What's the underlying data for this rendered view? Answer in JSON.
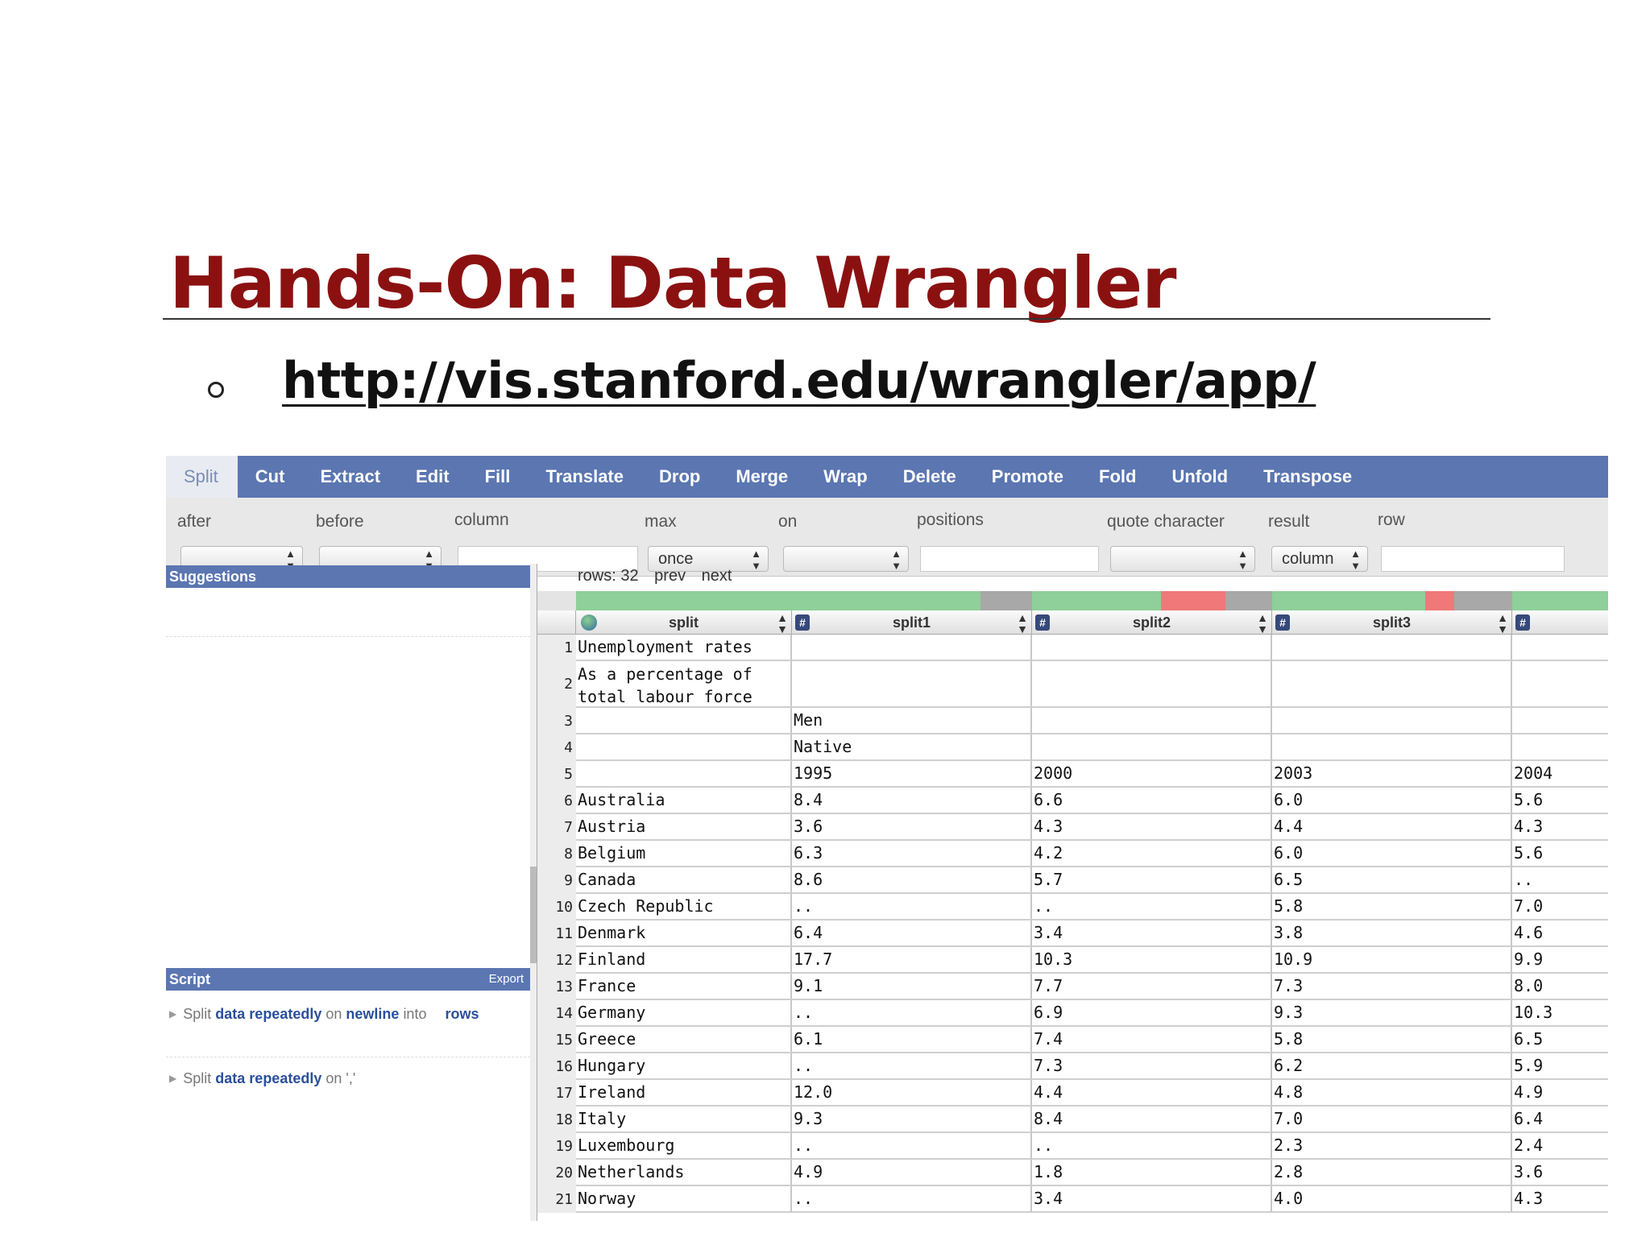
{
  "slide": {
    "title": "Hands-On: Data Wrangler",
    "link": "http://vis.stanford.edu/wrangler/app/"
  },
  "toolbar": {
    "tabs": [
      "Split",
      "Cut",
      "Extract",
      "Edit",
      "Fill",
      "Translate",
      "Drop",
      "Merge",
      "Wrap",
      "Delete",
      "Promote",
      "Fold",
      "Unfold",
      "Transpose"
    ],
    "active_tab": "Split"
  },
  "params": {
    "labels": {
      "after": "after",
      "before": "before",
      "column": "column",
      "max": "max",
      "on": "on",
      "positions": "positions",
      "quote_character": "quote character",
      "result": "result",
      "row": "row"
    },
    "max_value": "once",
    "result_value": "column"
  },
  "suggestions": {
    "title": "Suggestions"
  },
  "script": {
    "title": "Script",
    "export_label": "Export",
    "items": [
      {
        "verb": "Split",
        "kw1": "data",
        "kw2": "repeatedly",
        "mid": "on",
        "kw3": "newline",
        "tail": "into",
        "kw4": "rows"
      },
      {
        "verb": "Split",
        "kw1": "data",
        "kw2": "repeatedly",
        "mid": "on",
        "tail": "','"
      }
    ]
  },
  "grid": {
    "rows_label": "rows: 32",
    "prev_label": "prev",
    "next_label": "next",
    "columns": [
      "split",
      "split1",
      "split2",
      "split3"
    ],
    "colors": {
      "valid": "#8fcf9a",
      "missing": "#a8a8a8",
      "error": "#f07878"
    },
    "rows": [
      {
        "n": "1",
        "c": [
          "Unemployment rates",
          "",
          "",
          "",
          ""
        ]
      },
      {
        "n": "2",
        "c": [
          "As a percentage of total labour force",
          "",
          "",
          "",
          ""
        ]
      },
      {
        "n": "3",
        "c": [
          "",
          "Men",
          "",
          "",
          ""
        ]
      },
      {
        "n": "4",
        "c": [
          "",
          "Native",
          "",
          "",
          ""
        ]
      },
      {
        "n": "5",
        "c": [
          "",
          "1995",
          "2000",
          "2003",
          "2004"
        ]
      },
      {
        "n": "6",
        "c": [
          "Australia",
          "8.4",
          "6.6",
          "6.0",
          "5.6"
        ]
      },
      {
        "n": "7",
        "c": [
          "Austria",
          "3.6",
          "4.3",
          "4.4",
          "4.3"
        ]
      },
      {
        "n": "8",
        "c": [
          "Belgium",
          "6.3",
          "4.2",
          "6.0",
          "5.6"
        ]
      },
      {
        "n": "9",
        "c": [
          "Canada",
          "8.6",
          "5.7",
          "6.5",
          ".."
        ]
      },
      {
        "n": "10",
        "c": [
          "Czech Republic",
          "..",
          "..",
          "5.8",
          "7.0"
        ]
      },
      {
        "n": "11",
        "c": [
          "Denmark",
          "6.4",
          "3.4",
          "3.8",
          "4.6"
        ]
      },
      {
        "n": "12",
        "c": [
          "Finland",
          "17.7",
          "10.3",
          "10.9",
          "9.9"
        ]
      },
      {
        "n": "13",
        "c": [
          "France",
          "9.1",
          "7.7",
          "7.3",
          "8.0"
        ]
      },
      {
        "n": "14",
        "c": [
          "Germany",
          "..",
          "6.9",
          "9.3",
          "10.3"
        ]
      },
      {
        "n": "15",
        "c": [
          "Greece",
          "6.1",
          "7.4",
          "5.8",
          "6.5"
        ]
      },
      {
        "n": "16",
        "c": [
          "Hungary",
          "..",
          "7.3",
          "6.2",
          "5.9"
        ]
      },
      {
        "n": "17",
        "c": [
          "Ireland",
          "12.0",
          "4.4",
          "4.8",
          "4.9"
        ]
      },
      {
        "n": "18",
        "c": [
          "Italy",
          "9.3",
          "8.4",
          "7.0",
          "6.4"
        ]
      },
      {
        "n": "19",
        "c": [
          "Luxembourg",
          "..",
          "..",
          "2.3",
          "2.4"
        ]
      },
      {
        "n": "20",
        "c": [
          "Netherlands",
          "4.9",
          "1.8",
          "2.8",
          "3.6"
        ]
      },
      {
        "n": "21",
        "c": [
          "Norway",
          "..",
          "3.4",
          "4.0",
          "4.3"
        ]
      }
    ]
  }
}
